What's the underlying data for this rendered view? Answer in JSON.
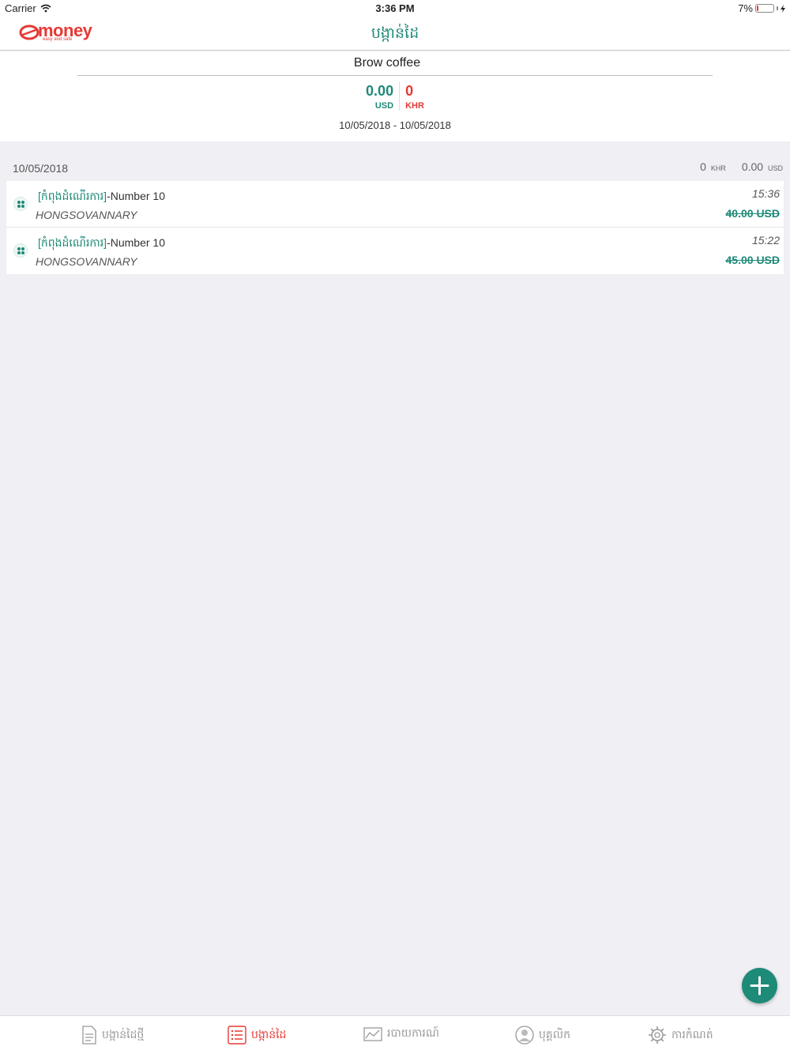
{
  "status_bar": {
    "carrier": "Carrier",
    "time": "3:36 PM",
    "battery": "7%",
    "battery_level": 0.07
  },
  "header": {
    "title": "បង្កាន់ដៃ",
    "logo_text": "money",
    "logo_tagline": "easy and safe"
  },
  "summary": {
    "shop_name": "Brow coffee",
    "usd_total": "0.00",
    "usd_label": "USD",
    "khr_total": "0",
    "khr_label": "KHR",
    "date_range": "10/05/2018 - 10/05/2018"
  },
  "group": {
    "date": "10/05/2018",
    "khr_total": "0",
    "khr_unit": "KHR",
    "usd_total": "0.00",
    "usd_unit": "USD"
  },
  "transactions": [
    {
      "status": "[កំពុងដំណើរការ]",
      "number": "-Number 10",
      "customer": "HONGSOVANNARY",
      "time": "15:36",
      "amount": "40.00 USD"
    },
    {
      "status": "[កំពុងដំណើរការ]",
      "number": "-Number 10",
      "customer": "HONGSOVANNARY",
      "time": "15:22",
      "amount": "45.00 USD"
    }
  ],
  "fab": {
    "icon": "plus-icon"
  },
  "tabs": [
    {
      "label": "បង្កាន់ដៃថ្មី",
      "icon": "document-icon",
      "active": false
    },
    {
      "label": "បង្កាន់ដៃ",
      "icon": "list-icon",
      "active": true
    },
    {
      "label": "របាយការណ៍",
      "icon": "chart-icon",
      "active": false
    },
    {
      "label": "បុគ្គលិក",
      "icon": "user-icon",
      "active": false
    },
    {
      "label": "ការកំណត់",
      "icon": "gear-icon",
      "active": false
    }
  ],
  "colors": {
    "brand_green": "#1e8a78",
    "brand_red": "#e53935",
    "background": "#efeff4"
  }
}
